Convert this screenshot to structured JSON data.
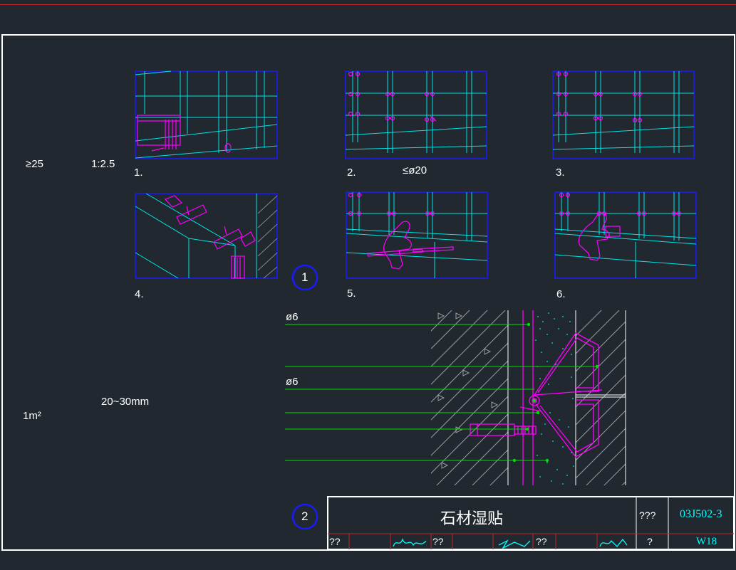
{
  "drawing": {
    "title": "石材湿贴",
    "drawing_number": "03J502-3",
    "page": "W18",
    "atlas_label": "???",
    "page_label": "?",
    "signature_labels": [
      "??",
      "??",
      "??"
    ]
  },
  "annotations": {
    "min_thickness": "≥25",
    "mortar_ratio": "1:2.5",
    "rebar_dia": "≤ø20",
    "gap_range": "20~30mm",
    "area": "1m²",
    "wire_dia_1": "ø6",
    "wire_dia_2": "ø6"
  },
  "steps": [
    "1.",
    "2.",
    "3.",
    "4.",
    "5.",
    "6."
  ],
  "callouts": [
    "1",
    "2"
  ],
  "colors": {
    "background": "#212830",
    "cyan": "#00e5e5",
    "magenta": "#ff00ff",
    "green": "#00e000",
    "frame_blue": "#1a1aff",
    "border": "#ffffff",
    "text_cyan": "#00ffff"
  }
}
